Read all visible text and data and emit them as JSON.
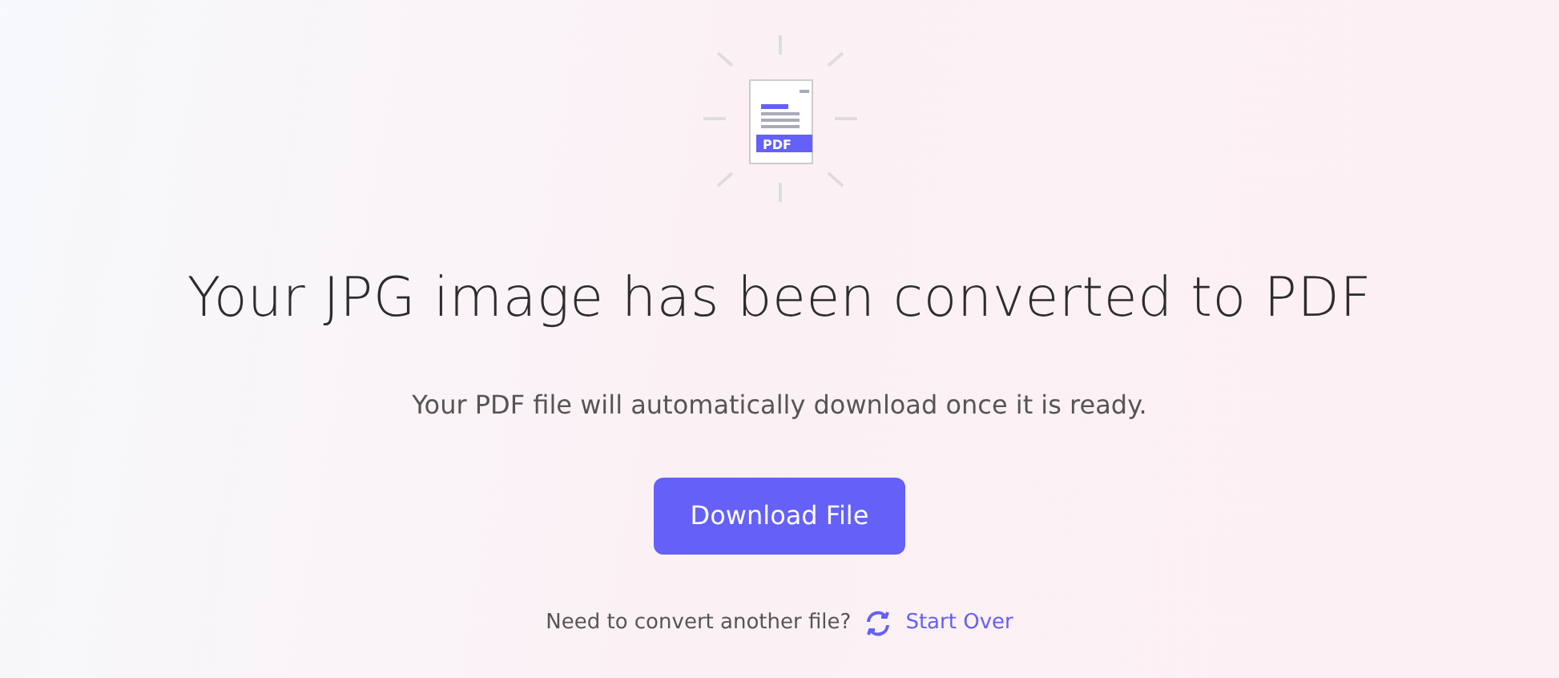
{
  "icon": {
    "label": "PDF"
  },
  "heading": "Your JPG image has been converted to PDF",
  "subtitle": "Your PDF file will automatically download once it is ready.",
  "button": "Download File",
  "footer": {
    "text": "Need to convert another file?",
    "link": "Start Over"
  }
}
